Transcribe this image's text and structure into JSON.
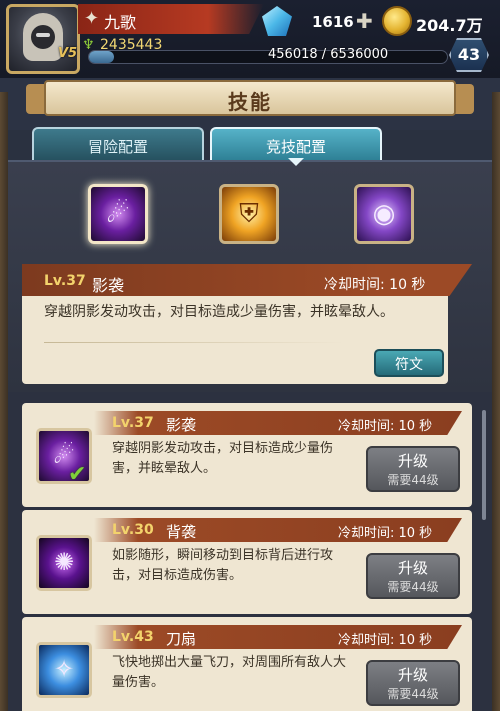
{
  "player": {
    "name": "九歌",
    "vip_label": "V5",
    "power": "2435443",
    "level": "43",
    "exp_text": "456018 / 6536000",
    "exp_progress": 0.07
  },
  "currency": {
    "gems": "1616",
    "gold": "204.7万"
  },
  "page": {
    "title": "技能"
  },
  "tabs": [
    {
      "label": "冒险配置",
      "active": false
    },
    {
      "label": "竞技配置",
      "active": true
    }
  ],
  "selected_skill": {
    "level": "Lv.37",
    "name": "影袭",
    "cooldown": "冷却时间: 10 秒",
    "description": "穿越阴影发动攻击，对目标造成少量伤害，并眩晕敌人。",
    "rune_button": "符文"
  },
  "skill_slots": [
    {
      "icon": "shadow-strike-icon",
      "selected": true
    },
    {
      "icon": "shield-break-icon",
      "selected": false
    },
    {
      "icon": "vortex-icon",
      "selected": false
    }
  ],
  "skills": [
    {
      "level": "Lv.37",
      "name": "影袭",
      "cooldown": "冷却时间: 10 秒",
      "description": "穿越阴影发动攻击，对目标造成少量伤害，并眩晕敌人。",
      "upgrade_label": "升级",
      "upgrade_cost": "需要44级",
      "equipped": true
    },
    {
      "level": "Lv.30",
      "name": "背袭",
      "cooldown": "冷却时间: 10 秒",
      "description": "如影随形，瞬间移动到目标背后进行攻击，对目标造成伤害。",
      "upgrade_label": "升级",
      "upgrade_cost": "需要44级",
      "equipped": false
    },
    {
      "level": "Lv.43",
      "name": "刀扇",
      "cooldown": "冷却时间: 10 秒",
      "description": "飞快地掷出大量飞刀，对周围所有敌人大量伤害。",
      "upgrade_label": "升级",
      "upgrade_cost": "需要44级",
      "equipped": false
    }
  ],
  "colors": {
    "banner": "#9c4a26",
    "parchment": "#efe6d2",
    "accent_teal": "#56b2c8",
    "level_gold": "#f3d36c"
  }
}
